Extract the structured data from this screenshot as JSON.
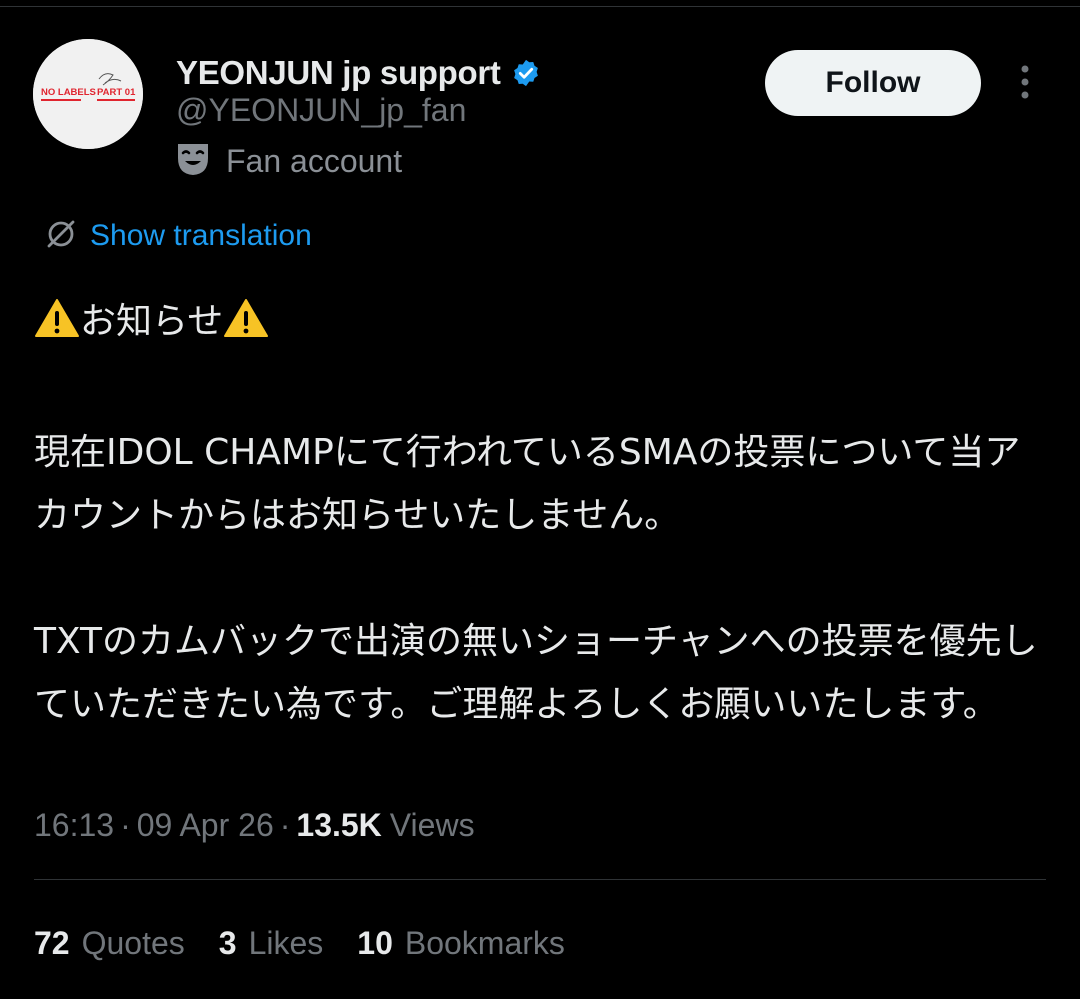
{
  "profile": {
    "display_name": "YEONJUN jp support",
    "handle": "@YEONJUN_jp_fan",
    "account_label": "Fan account",
    "avatar_texts": [
      "NO LABELS",
      "PART 01"
    ]
  },
  "actions": {
    "follow_label": "Follow"
  },
  "translation": {
    "label": "Show translation"
  },
  "tweet": {
    "heading": "お知らせ",
    "paragraph1": "現在IDOL CHAMPにて行われているSMAの投票について当アカウントからはお知らせいたしません。",
    "paragraph2": "TXTのカムバックで出演の無いショーチャンへの投票を優先していただきたい為です。ご理解よろしくお願いいたします。"
  },
  "meta": {
    "time": "16:13",
    "separator": "·",
    "date": "09 Apr 26",
    "views_count": "13.5K",
    "views_label": "Views"
  },
  "stats": [
    {
      "count": "72",
      "label": "Quotes"
    },
    {
      "count": "3",
      "label": "Likes"
    },
    {
      "count": "10",
      "label": "Bookmarks"
    }
  ],
  "icons": {
    "verified": "verified-badge-icon",
    "account_type": "theater-mask-icon",
    "translate": "translate-globe-icon",
    "more": "more-vertical-icon",
    "warning": "warning-icon"
  },
  "colors": {
    "background": "#000000",
    "text": "#e7e9ea",
    "muted": "#71767b",
    "accent": "#1d9bf0",
    "avatar_red": "#e0252f"
  }
}
